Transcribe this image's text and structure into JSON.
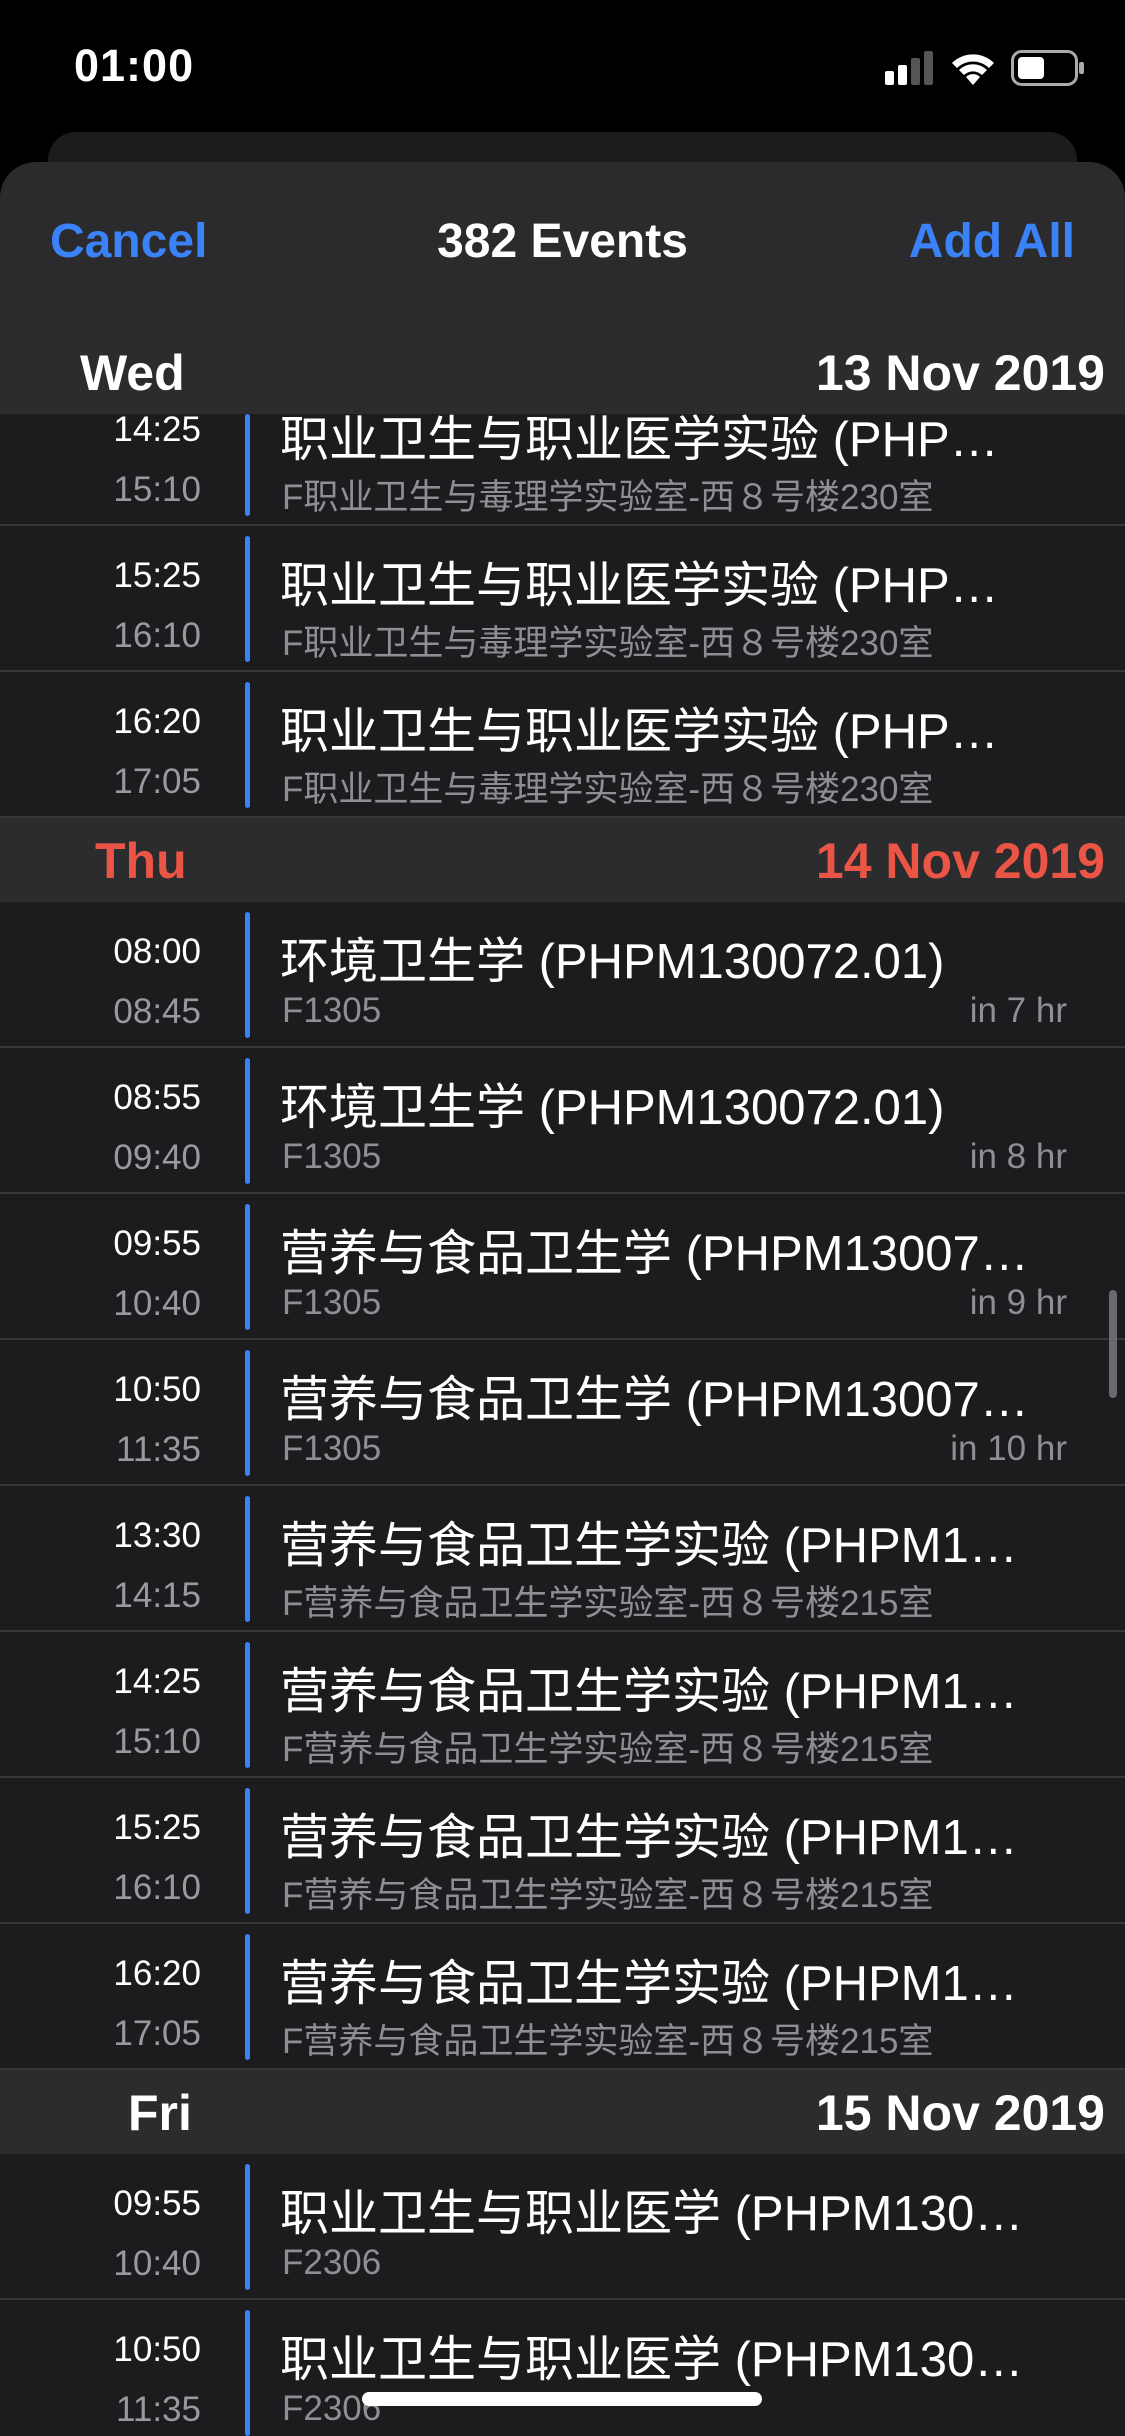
{
  "status_bar": {
    "time": "01:00"
  },
  "navbar": {
    "cancel_label": "Cancel",
    "title": "382 Events",
    "add_all_label": "Add All"
  },
  "days": [
    {
      "weekday": "Wed",
      "date": "13 Nov 2019",
      "is_today": false,
      "events": [
        {
          "start": "14:25",
          "end": "15:10",
          "title": "职业卫生与职业医学实验 (PHP…",
          "location": "F职业卫生与毒理学实验室-西８号楼230室",
          "relative": "",
          "partial": true
        },
        {
          "start": "15:25",
          "end": "16:10",
          "title": "职业卫生与职业医学实验 (PHP…",
          "location": "F职业卫生与毒理学实验室-西８号楼230室",
          "relative": ""
        },
        {
          "start": "16:20",
          "end": "17:05",
          "title": "职业卫生与职业医学实验 (PHP…",
          "location": "F职业卫生与毒理学实验室-西８号楼230室",
          "relative": ""
        }
      ]
    },
    {
      "weekday": "Thu",
      "date": "14 Nov 2019",
      "is_today": true,
      "events": [
        {
          "start": "08:00",
          "end": "08:45",
          "title": "环境卫生学 (PHPM130072.01)",
          "location": "F1305",
          "relative": "in 7 hr"
        },
        {
          "start": "08:55",
          "end": "09:40",
          "title": "环境卫生学 (PHPM130072.01)",
          "location": "F1305",
          "relative": "in 8 hr"
        },
        {
          "start": "09:55",
          "end": "10:40",
          "title": "营养与食品卫生学 (PHPM13007…",
          "location": "F1305",
          "relative": "in 9 hr"
        },
        {
          "start": "10:50",
          "end": "11:35",
          "title": "营养与食品卫生学 (PHPM13007…",
          "location": "F1305",
          "relative": "in 10 hr"
        },
        {
          "start": "13:30",
          "end": "14:15",
          "title": "营养与食品卫生学实验 (PHPM1…",
          "location": "F营养与食品卫生学实验室-西８号楼215室",
          "relative": ""
        },
        {
          "start": "14:25",
          "end": "15:10",
          "title": "营养与食品卫生学实验 (PHPM1…",
          "location": "F营养与食品卫生学实验室-西８号楼215室",
          "relative": ""
        },
        {
          "start": "15:25",
          "end": "16:10",
          "title": "营养与食品卫生学实验 (PHPM1…",
          "location": "F营养与食品卫生学实验室-西８号楼215室",
          "relative": ""
        },
        {
          "start": "16:20",
          "end": "17:05",
          "title": "营养与食品卫生学实验 (PHPM1…",
          "location": "F营养与食品卫生学实验室-西８号楼215室",
          "relative": ""
        }
      ]
    },
    {
      "weekday": "Fri",
      "date": "15 Nov 2019",
      "is_today": false,
      "events": [
        {
          "start": "09:55",
          "end": "10:40",
          "title": "职业卫生与职业医学 (PHPM130…",
          "location": "F2306",
          "relative": ""
        },
        {
          "start": "10:50",
          "end": "11:35",
          "title": "职业卫生与职业医学 (PHPM130…",
          "location": "F2306",
          "relative": ""
        }
      ]
    }
  ],
  "colors": {
    "accent": "#3a82f7",
    "today": "#eb5546",
    "background": "#1c1c1e"
  },
  "icons": [
    "cellular-signal-icon",
    "wifi-icon",
    "battery-icon"
  ]
}
